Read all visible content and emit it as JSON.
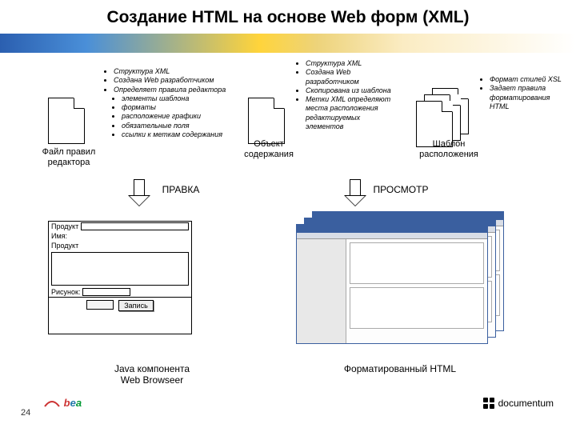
{
  "title": "Создание HTML на основе Web форм (XML)",
  "file_rules": {
    "label": "Файл правил\nредактора",
    "bullets": [
      "Структура XML",
      "Создана Web разработчиком",
      "Определяет правила редактора"
    ],
    "sub_bullets": [
      "элементы шаблона",
      "форматы",
      "расположение графики",
      "обязательные поля",
      "ссылки к меткам содержания"
    ]
  },
  "content_obj": {
    "label": "Объект\nсодержания",
    "bullets": [
      "Структура XML",
      "Создана Web разработчиком",
      "Скопирована из шаблона",
      "Метки XML определяют места расположения редактируемых элементов"
    ]
  },
  "layout_tpl": {
    "label": "Шаблон\nрасположения",
    "bullets": [
      "Формат стилей XSL",
      "Задает правила форматирования HTML"
    ]
  },
  "arrows": {
    "left_label": "ПРАВКА",
    "right_label": "ПРОСМОТР"
  },
  "form": {
    "product_label": "Продукт",
    "name_label": "Имя:",
    "product2_label": "Продукт",
    "image_label": "Рисунок:",
    "submit_label": "Запись"
  },
  "captions": {
    "left_bottom": "Java компонента\nWeb Browseer",
    "right_bottom": "Форматированный HTML"
  },
  "footer": {
    "page": "24",
    "bea": "bea",
    "documentum": "documentum"
  }
}
